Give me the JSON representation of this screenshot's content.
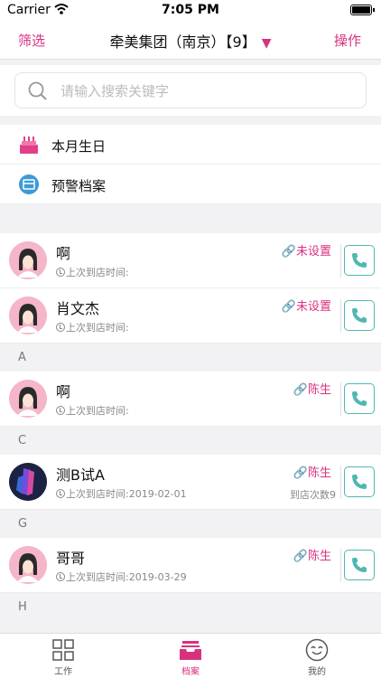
{
  "status_bar": {
    "carrier": "Carrier",
    "time": "7:05 PM"
  },
  "nav": {
    "filter_label": "筛选",
    "title": "牵美集团（南京）【9】",
    "dropdown_glyph": "▼",
    "action_label": "操作"
  },
  "search": {
    "placeholder": "请输入搜索关键字",
    "value": ""
  },
  "shortcuts": [
    {
      "label": "本月生日",
      "icon": "birthday-cake-icon"
    },
    {
      "label": "预警档案",
      "icon": "warning-archive-icon"
    }
  ],
  "contacts_top": [
    {
      "name": "啊",
      "visit_label": "上次到店时间:",
      "visit_date": "",
      "tag": "未设置",
      "count": ""
    },
    {
      "name": "肖文杰",
      "visit_label": "上次到店时间:",
      "visit_date": "",
      "tag": "未设置",
      "count": ""
    }
  ],
  "sections": [
    {
      "letter": "A",
      "contacts": [
        {
          "name": "啊",
          "visit_label": "上次到店时间:",
          "visit_date": "",
          "tag": "陈生",
          "count": ""
        }
      ]
    },
    {
      "letter": "C",
      "contacts": [
        {
          "name": "测B试A",
          "visit_label": "上次到店时间:",
          "visit_date": "2019-02-01",
          "tag": "陈生",
          "count": "到店次数9"
        }
      ]
    },
    {
      "letter": "G",
      "contacts": [
        {
          "name": "哥哥",
          "visit_label": "上次到店时间:",
          "visit_date": "2019-03-29",
          "tag": "陈生",
          "count": ""
        }
      ]
    },
    {
      "letter": "H",
      "contacts": []
    }
  ],
  "tabs": [
    {
      "label": "工作",
      "icon": "grid-icon",
      "active": false
    },
    {
      "label": "档案",
      "icon": "archive-icon",
      "active": true
    },
    {
      "label": "我的",
      "icon": "smiley-icon",
      "active": false
    }
  ],
  "colors": {
    "accent": "#d8327f",
    "phone_button": "#4fb8b0"
  }
}
